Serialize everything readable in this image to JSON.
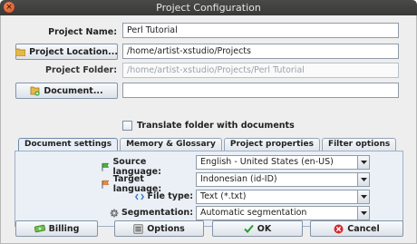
{
  "window": {
    "title": "Project Configuration",
    "close_glyph": "×"
  },
  "form": {
    "project_name_label": "Project Name:",
    "project_name_value": "Perl Tutorial",
    "project_location_button": "Project Location...",
    "project_location_value": "/home/artist-xstudio/Projects",
    "project_folder_label": "Project Folder:",
    "project_folder_value": "/home/artist-xstudio/Projects/Perl Tutorial",
    "document_button": "Document...",
    "document_value": "",
    "translate_checkbox_label": "Translate folder with documents",
    "translate_checked": false
  },
  "tabs": [
    {
      "label": "Document settings",
      "active": true
    },
    {
      "label": "Memory & Glossary",
      "active": false
    },
    {
      "label": "Project properties",
      "active": false
    },
    {
      "label": "Filter options",
      "active": false
    }
  ],
  "settings": {
    "source_language_label": "Source language:",
    "source_language_value": "English - United States (en-US)",
    "target_language_label": "Target language:",
    "target_language_value": "Indonesian (id-ID)",
    "file_type_label": "File type:",
    "file_type_value": "Text (*.txt)",
    "segmentation_label": "Segmentation:",
    "segmentation_value": "Automatic segmentation"
  },
  "footer": {
    "billing_label": "Billing",
    "options_label": "Options",
    "ok_label": "OK",
    "cancel_label": "Cancel"
  },
  "icons": {
    "source_flag": "flag-green-icon",
    "target_flag": "flag-orange-icon",
    "file_type": "code-brackets-icon",
    "segmentation": "gear-icon",
    "project_location": "folder-icon",
    "document": "document-add-icon",
    "billing": "money-icon",
    "options": "options-icon",
    "ok": "checkmark-icon",
    "cancel": "cancel-icon"
  },
  "colors": {
    "titlebar": "#3f3f3d",
    "dialog_bg": "#eeeeee",
    "panel_bg": "#eaf0f6",
    "ok_green": "#2e9b2e",
    "cancel_red": "#d62b2b"
  }
}
